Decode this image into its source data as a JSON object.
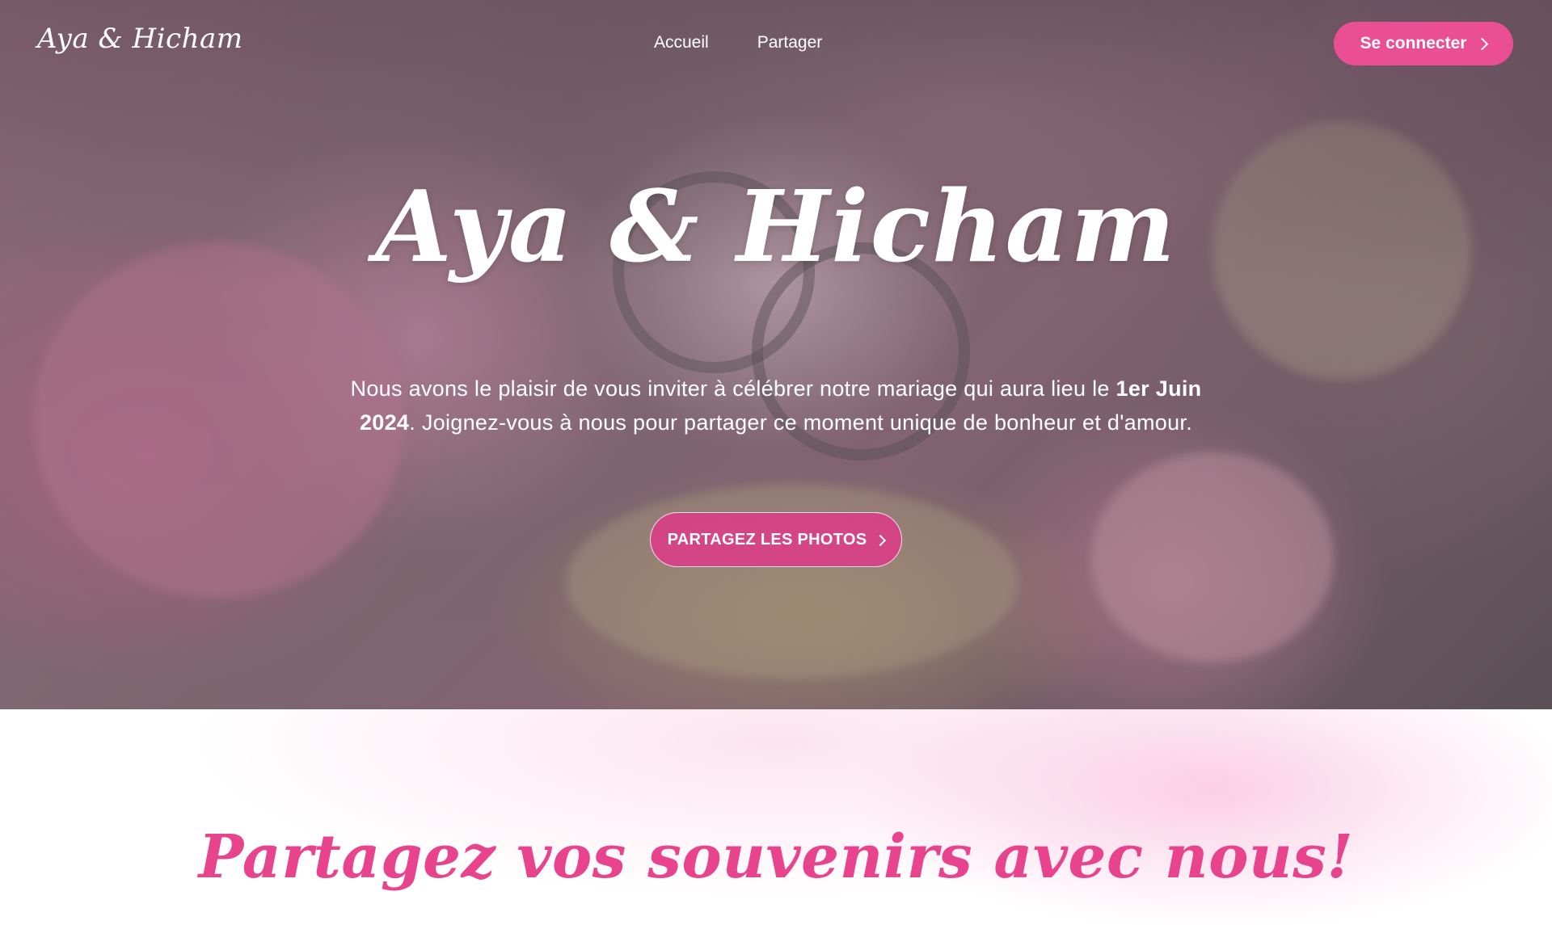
{
  "nav": {
    "logo": "Aya & Hicham",
    "links": [
      "Accueil",
      "Partager"
    ],
    "login_label": "Se connecter"
  },
  "hero": {
    "title": "Aya & Hicham",
    "text_before": "Nous avons le plaisir de vous inviter à célébrer notre mariage qui aura lieu le ",
    "date": "1er Juin 2024",
    "text_after": ". Joignez-vous à nous pour partager ce moment unique de bonheur et d'amour.",
    "cta_label": "PARTAGEZ LES PHOTOS"
  },
  "share": {
    "title": "Partagez vos souvenirs avec nous!"
  },
  "colors": {
    "accent": "#ea4f93",
    "title_pink": "#e8448e"
  },
  "icons": {
    "login_chevron": "chevron-right-icon",
    "cta_chevron": "chevron-right-icon"
  }
}
